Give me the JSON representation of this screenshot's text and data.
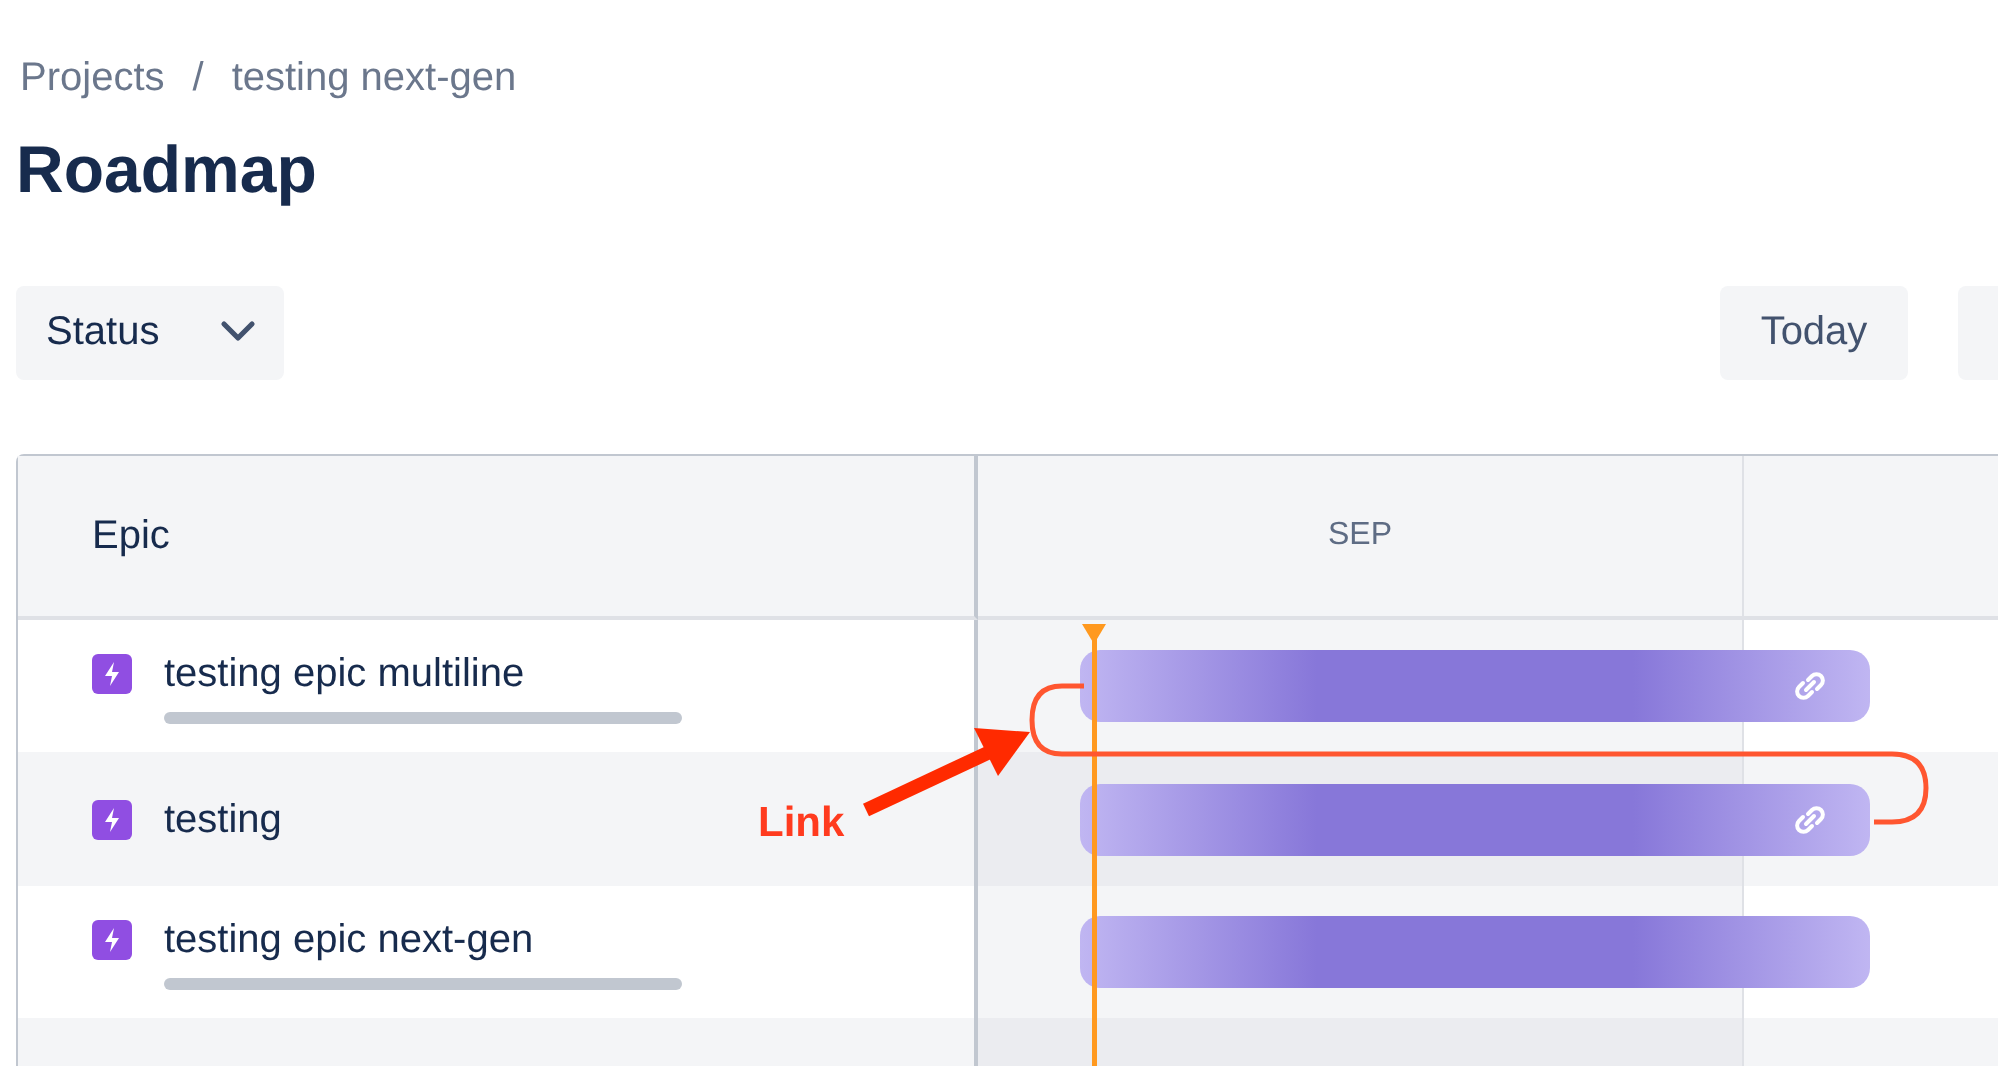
{
  "breadcrumbs": [
    "Projects",
    "testing next-gen"
  ],
  "breadcrumb_separator": "/",
  "title": "Roadmap",
  "filters": {
    "status_dropdown": "Status"
  },
  "toolbar": {
    "today_button": "Today"
  },
  "table": {
    "epic_header": "Epic",
    "month_header": "SEP",
    "epics": [
      {
        "name": "testing epic multiline",
        "progress": {
          "level": 0
        },
        "linked": true
      },
      {
        "name": "testing",
        "linked": true
      },
      {
        "name": "testing epic next-gen",
        "progress": {
          "level": 0
        },
        "linked": false
      }
    ]
  },
  "annotation": {
    "label": "Link"
  }
}
